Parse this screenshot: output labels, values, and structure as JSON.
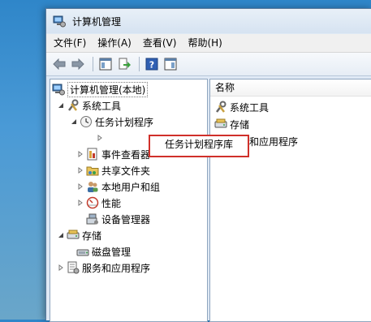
{
  "window": {
    "title": "计算机管理"
  },
  "menu": {
    "items": [
      "文件(F)",
      "操作(A)",
      "查看(V)",
      "帮助(H)"
    ]
  },
  "tree": {
    "root": "计算机管理(本地)",
    "system_tools": "系统工具",
    "task_scheduler": "任务计划程序",
    "task_scheduler_library": "任务计划程序库",
    "event_viewer": "事件查看器",
    "shared_folders": "共享文件夹",
    "local_users_groups": "本地用户和组",
    "performance": "性能",
    "device_manager": "设备管理器",
    "storage": "存储",
    "disk_management": "磁盘管理",
    "services_apps": "服务和应用程序"
  },
  "list": {
    "column_name": "名称",
    "items": [
      "系统工具",
      "存储",
      "服务和应用程序"
    ]
  },
  "colors": {
    "highlight_border": "#d0302a"
  }
}
